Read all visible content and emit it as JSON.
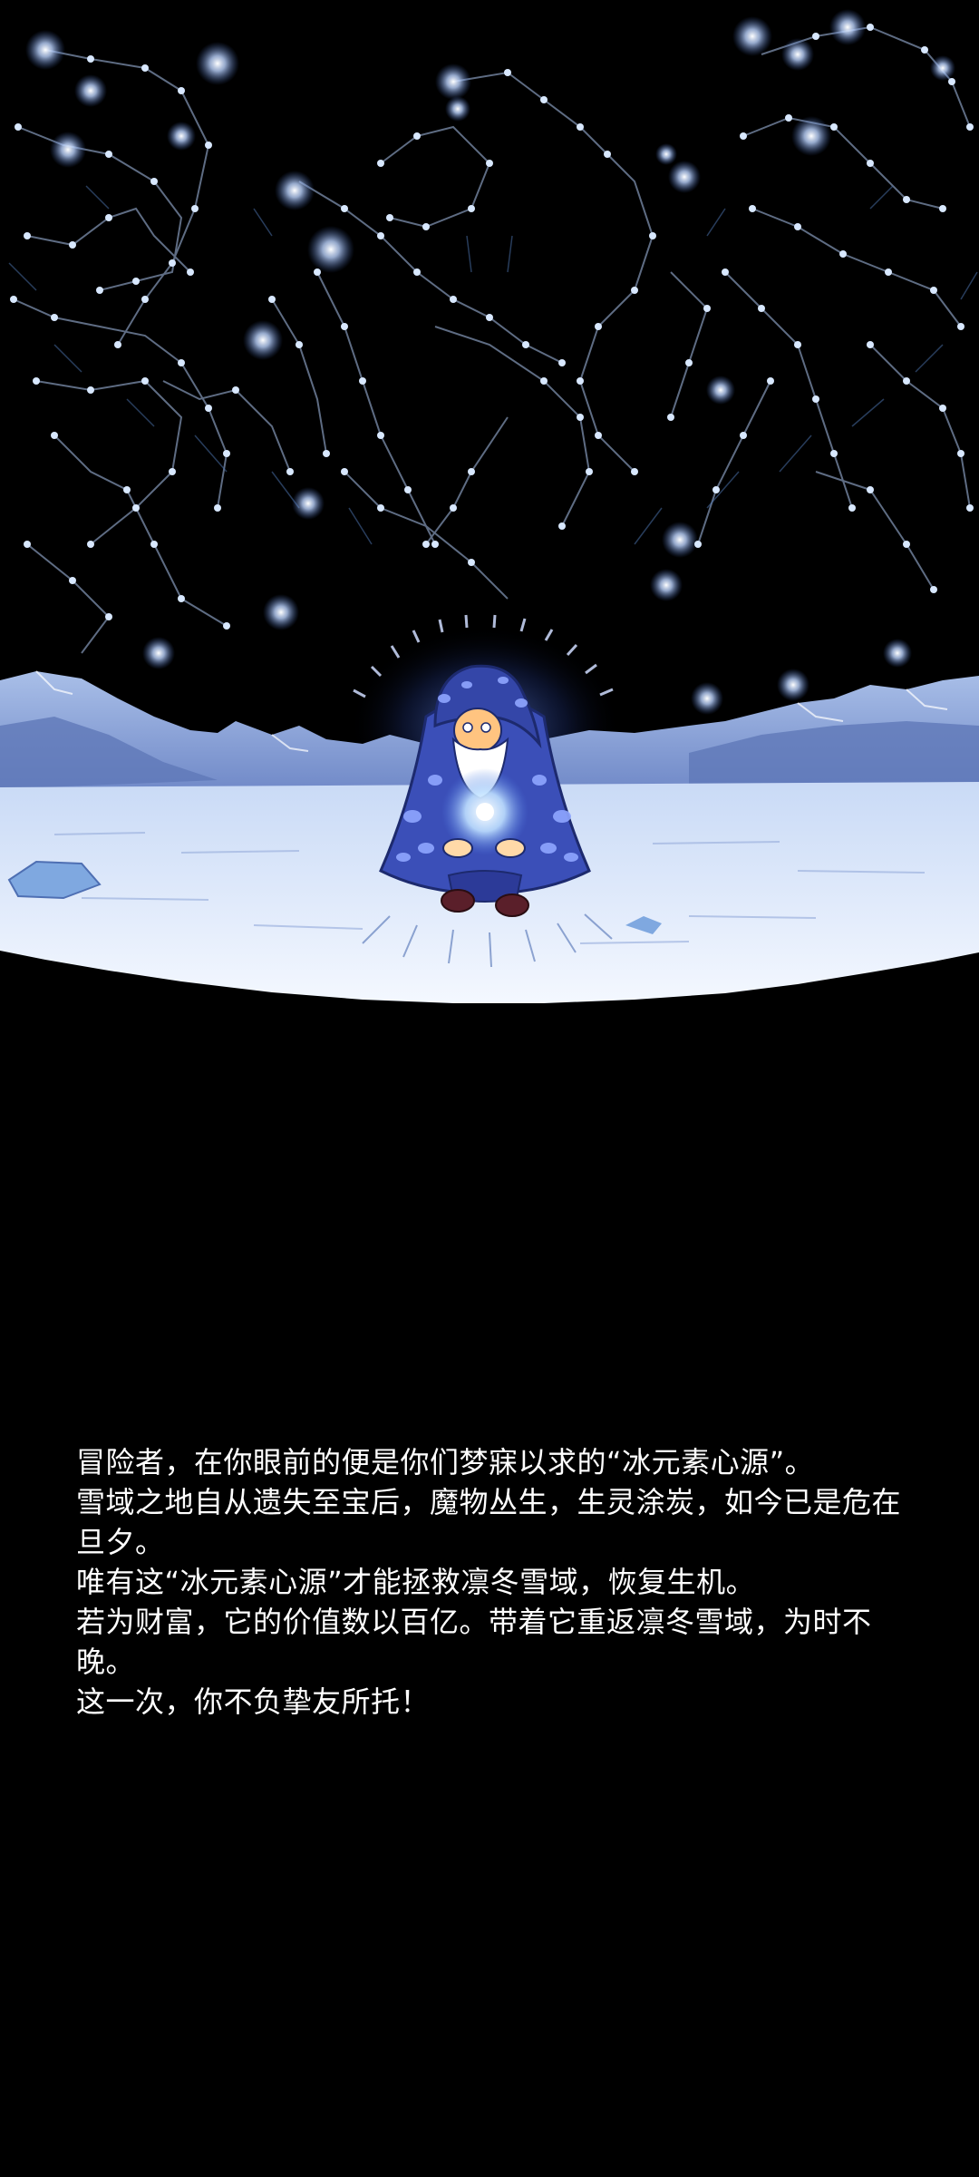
{
  "scene": {
    "illustration": "ice-wizard-under-constellations",
    "colors": {
      "sky": "#000000",
      "star": "#d8e8ff",
      "constellation_line": "#6f7f9a",
      "snow": "#eef4ff",
      "mountain": "#8ea8dc",
      "mountain_shadow": "#5f78b8",
      "robe": "#3b4fb8",
      "robe_spots": "#8fa6ff",
      "beard": "#ffffff",
      "face": "#ffc480",
      "boots": "#5a1f2a",
      "orb_glow": "#bfe0ff"
    }
  },
  "story": {
    "lines": [
      "冒险者，在你眼前的便是你们梦寐以求的“冰元素心源”。",
      "雪域之地自从遗失至宝后，魔物丛生，生灵涂炭，如今已是危在旦夕。",
      "唯有这“冰元素心源”才能拯救凛冬雪域，恢复生机。",
      "若为财富，它的价值数以百亿。带着它重返凛冬雪域，为时不晚。",
      "这一次，你不负挚友所托！"
    ]
  }
}
